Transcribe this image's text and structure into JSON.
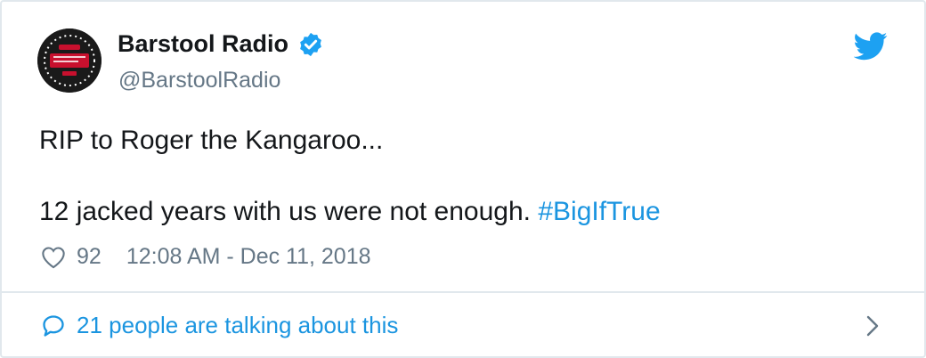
{
  "account": {
    "display_name": "Barstool Radio",
    "handle": "@BarstoolRadio",
    "verified": true
  },
  "tweet": {
    "line1": "RIP to Roger the Kangaroo...",
    "line2_text": "12 jacked years with us were not enough. ",
    "hashtag": "#BigIfTrue"
  },
  "meta": {
    "like_count": "92",
    "timestamp": "12:08 AM - Dec 11, 2018"
  },
  "footer": {
    "conversation_label": "21 people are talking about this"
  },
  "icons": {
    "bird": "twitter-bird-icon",
    "verified": "verified-badge-icon",
    "heart": "heart-icon",
    "bubble": "comment-bubble-icon",
    "chevron": "chevron-right-icon"
  },
  "colors": {
    "link": "#1b95e0",
    "muted": "#657786",
    "text": "#14171a",
    "border": "#e1e8ed"
  }
}
